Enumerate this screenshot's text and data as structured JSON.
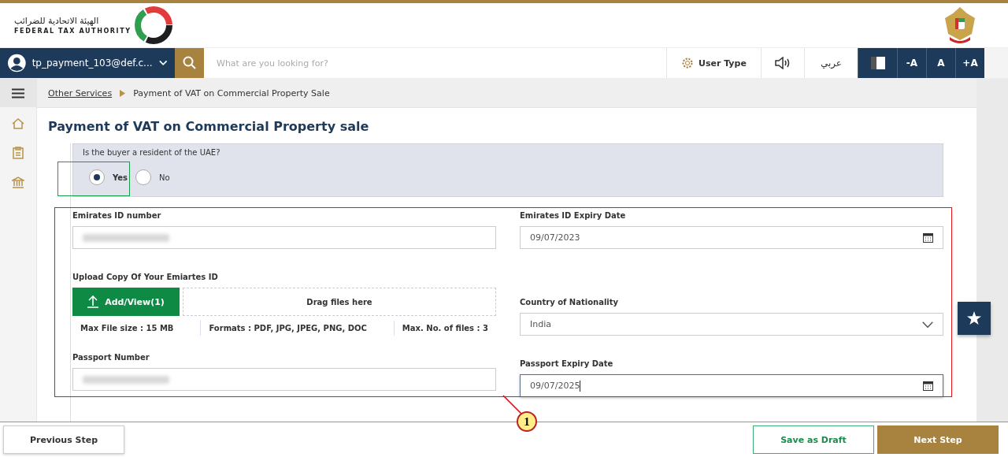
{
  "header": {
    "logo_arabic": "الهيئة الاتحادية للضرائب",
    "logo_english": "FEDERAL TAX AUTHORITY"
  },
  "navbar": {
    "user": "tp_payment_103@def.c...",
    "search": {
      "placeholder": "What are you looking for?"
    },
    "user_type": "User Type",
    "language": "عربي",
    "font_sizes": [
      "-A",
      "A",
      "+A"
    ]
  },
  "breadcrumb": [
    {
      "label": "Other Services",
      "link": true
    },
    {
      "label": "Payment of VAT on Commercial Property Sale",
      "link": false
    }
  ],
  "page_title": "Payment of VAT on Commercial Property sale",
  "question": {
    "label": "Is the buyer a resident of the UAE?",
    "options": [
      {
        "label": "Yes",
        "selected": true
      },
      {
        "label": "No",
        "selected": false
      }
    ]
  },
  "left_fields": [
    {
      "kind": "text",
      "label": "Emirates ID number",
      "redacted": true
    },
    {
      "kind": "upload",
      "label": "Upload Copy Of Your Emiartes ID",
      "button": "Add/View(1)",
      "drop": "Drag files here",
      "info": [
        "Max File size : 15 MB",
        "Formats : PDF, JPG, JPEG, PNG, DOC",
        "Max. No. of files : 3"
      ]
    },
    {
      "kind": "text",
      "label": "Passport Number",
      "redacted": true
    }
  ],
  "right_fields": [
    {
      "kind": "date",
      "label": "Emirates ID Expiry Date",
      "value": "09/07/2023",
      "focused": false
    },
    {
      "kind": "select",
      "label": "Country of Nationality",
      "value": "India"
    },
    {
      "kind": "date",
      "label": "Passport Expiry Date",
      "value": "09/07/2025",
      "focused": true
    }
  ],
  "footer": {
    "previous": "Previous Step",
    "draft": "Save as Draft",
    "next": "Next Step"
  },
  "callout": "1"
}
